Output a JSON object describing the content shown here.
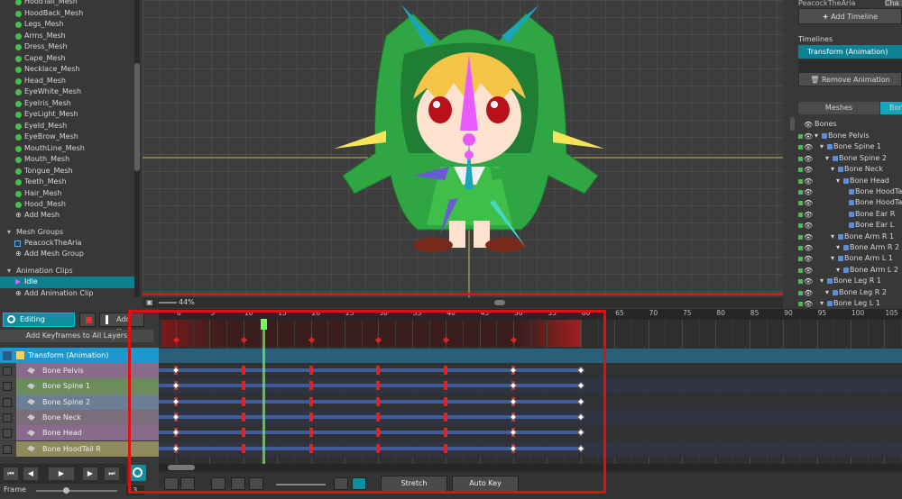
{
  "hierarchy": {
    "meshes": [
      "HoodTail_Mesh",
      "HoodBack_Mesh",
      "Legs_Mesh",
      "Arms_Mesh",
      "Dress_Mesh",
      "Cape_Mesh",
      "Necklace_Mesh",
      "Head_Mesh",
      "EyeWhite_Mesh",
      "EyeIris_Mesh",
      "EyeLight_Mesh",
      "EyeId_Mesh",
      "EyeBrow_Mesh",
      "MouthLine_Mesh",
      "Mouth_Mesh",
      "Tongue_Mesh",
      "Teeth_Mesh",
      "Hair_Mesh",
      "Hood_Mesh"
    ],
    "add_mesh": "Add Mesh",
    "mesh_groups_header": "Mesh Groups",
    "mesh_group_item": "PeacockTheAria",
    "add_mesh_group": "Add Mesh Group",
    "animation_clips_header": "Animation Clips",
    "clip_item": "Idle",
    "add_clip": "Add Animation Clip"
  },
  "viewport": {
    "zoom": "44%"
  },
  "right_panel": {
    "top_label": "PeacockTheAria",
    "top_small": "Cha",
    "add_timeline": "Add Timeline",
    "timelines_label": "Timelines",
    "timeline_item": "Transform (Animation)",
    "remove_animation": "Remove Animation",
    "tab_meshes": "Meshes",
    "tab_bone": "Bone",
    "bones_root": "Bones",
    "bones": [
      {
        "name": "Bone Pelvis",
        "depth": 1
      },
      {
        "name": "Bone Spine 1",
        "depth": 2
      },
      {
        "name": "Bone Spine 2",
        "depth": 3
      },
      {
        "name": "Bone Neck",
        "depth": 4
      },
      {
        "name": "Bone Head",
        "depth": 5
      },
      {
        "name": "Bone HoodTa",
        "depth": 6
      },
      {
        "name": "Bone HoodTa",
        "depth": 6
      },
      {
        "name": "Bone Ear R",
        "depth": 6
      },
      {
        "name": "Bone Ear L",
        "depth": 6
      },
      {
        "name": "Bone Arm R 1",
        "depth": 4
      },
      {
        "name": "Bone Arm R 2",
        "depth": 5
      },
      {
        "name": "Bone Arm L 1",
        "depth": 4
      },
      {
        "name": "Bone Arm L 2",
        "depth": 5
      },
      {
        "name": "Bone Leg R 1",
        "depth": 2
      },
      {
        "name": "Bone Leg R 2",
        "depth": 3
      },
      {
        "name": "Bone Leg L 1",
        "depth": 2
      }
    ]
  },
  "anim_controls": {
    "editing": "Editing",
    "add_key": "Add Key",
    "add_keyframes_all": "Add Keyframes to All Layers",
    "frame_label": "Frame",
    "frame_value": "13"
  },
  "layers": {
    "group": "Transform (Animation)",
    "items": [
      "Bone Pelvis",
      "Bone Spine 1",
      "Bone Spine 2",
      "Bone Neck",
      "Bone Head",
      "Bone HoodTail R"
    ]
  },
  "timeline": {
    "ticks": [
      "0",
      "5",
      "10",
      "15",
      "20",
      "25",
      "30",
      "35",
      "40",
      "45",
      "50",
      "55",
      "60",
      "65",
      "70",
      "75",
      "80",
      "85",
      "90",
      "95",
      "100",
      "105"
    ],
    "current_frame": 13,
    "clip_end_frame": 60,
    "summary_keys": [
      0,
      10,
      20,
      30,
      40,
      50
    ],
    "red_keys": [
      0,
      10,
      20,
      30,
      40,
      50
    ],
    "white_keys": [
      0,
      50,
      60
    ],
    "stretch": "Stretch",
    "auto_key": "Auto Key"
  },
  "colors": {
    "accent_cyan": "#1aa6b8",
    "key_red": "#e02424",
    "playhead_green": "#6cff5a",
    "highlight_box": "#e01010"
  }
}
